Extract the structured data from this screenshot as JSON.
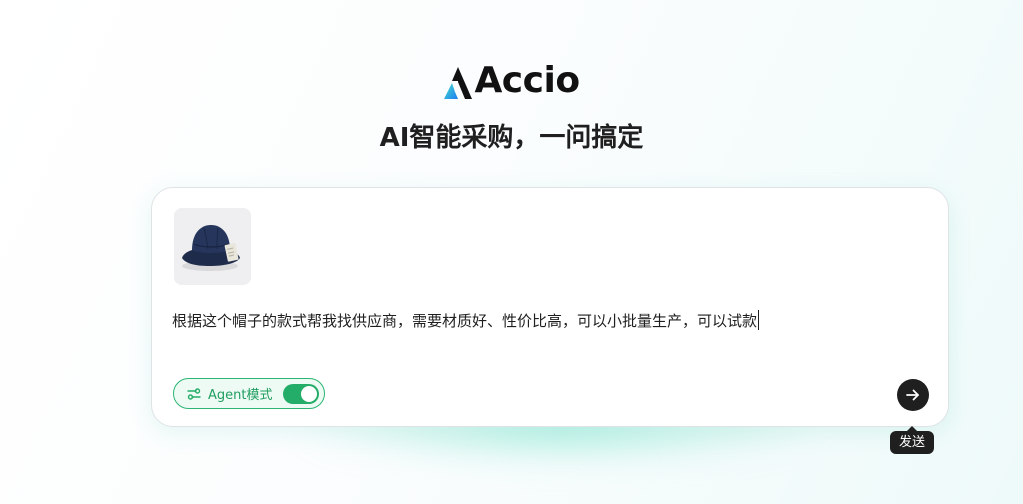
{
  "brand": {
    "name": "Accio",
    "logo_mark_icon": "triangle-a-gradient-icon",
    "gradient_colors": [
      "#48e0c9",
      "#1b7cf2"
    ]
  },
  "headline": "AI智能采购，一问搞定",
  "composer": {
    "attachment": {
      "icon": "bucket-hat-photo"
    },
    "prompt_text": "根据这个帽子的款式帮我找供应商，需要材质好、性价比高，可以小批量生产，可以试款",
    "agent_mode": {
      "icon": "agent-mode-icon",
      "label": "Agent模式",
      "enabled": true,
      "accent_color": "#24ad68"
    },
    "send": {
      "icon": "arrow-right-icon",
      "tooltip": "发送"
    }
  }
}
